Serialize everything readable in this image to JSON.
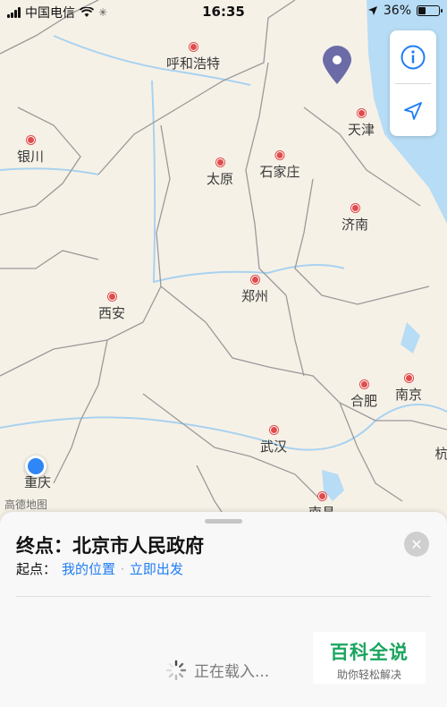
{
  "status": {
    "carrier": "中国电信",
    "time": "16:35",
    "battery_percent": "36%",
    "battery_level": 0.36
  },
  "map": {
    "attribution": "高德地图",
    "cities": [
      {
        "name": "呼和浩特"
      },
      {
        "name": "银川"
      },
      {
        "name": "天津"
      },
      {
        "name": "太原"
      },
      {
        "name": "石家庄"
      },
      {
        "name": "济南"
      },
      {
        "name": "郑州"
      },
      {
        "name": "西安"
      },
      {
        "name": "合肥"
      },
      {
        "name": "南京"
      },
      {
        "name": "武汉"
      },
      {
        "name": "重庆"
      },
      {
        "name": "南昌"
      },
      {
        "name": "杭"
      }
    ]
  },
  "controls": {
    "info_icon": "info-icon",
    "locate_icon": "location-arrow-icon"
  },
  "sheet": {
    "destination_prefix": "终点：",
    "destination": "北京市人民政府",
    "start_prefix": "起点：",
    "start_value": "我的位置",
    "separator": "·",
    "depart_label": "立即出发",
    "loading_text": "正在载入..."
  },
  "watermark": {
    "title": "百科全说",
    "subtitle": "助你轻松解决"
  },
  "colors": {
    "accent": "#1f7cf4",
    "city_dot": "#e04b4b",
    "pin": "#6b6ba8",
    "water": "#a9d2f0",
    "watermark_green": "#1aa55e"
  }
}
